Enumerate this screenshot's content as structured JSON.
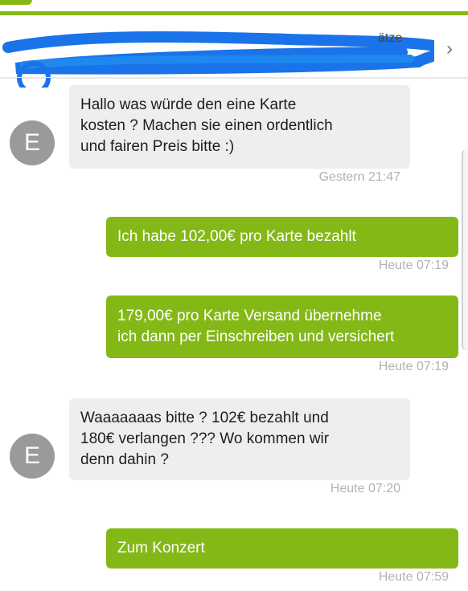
{
  "header": {
    "title_fragment": "ätze",
    "chevron": "›"
  },
  "messages": [
    {
      "avatar": "E",
      "text_lines": [
        "Hallo was würde den eine Karte",
        "kosten ? Machen sie einen ordentlich",
        "und fairen Preis bitte :)"
      ],
      "time": "Gestern 21:47"
    },
    {
      "text_lines": [
        "Ich habe 102,00€ pro Karte bezahlt"
      ],
      "time": "Heute 07:19"
    },
    {
      "text_lines": [
        "179,00€ pro Karte Versand übernehme",
        "ich dann per Einschreiben und versichert"
      ],
      "time": "Heute 07:19"
    },
    {
      "avatar": "E",
      "text_lines": [
        "Waaaaaaas bitte ? 102€ bezahlt und",
        "180€ verlangen ??? Wo kommen wir",
        "denn dahin ?"
      ],
      "time": "Heute 07:20"
    },
    {
      "text_lines": [
        "Zum Konzert"
      ],
      "time": "Heute 07:59"
    }
  ],
  "colors": {
    "accent": "#86b817",
    "incoming_bubble": "#eeeeee",
    "outgoing_bubble": "#84b817",
    "avatar": "#9a9a9a",
    "timestamp": "#b2b2b2",
    "scribble": "#1a73e8"
  },
  "icons": [
    "chevron-right-icon"
  ]
}
